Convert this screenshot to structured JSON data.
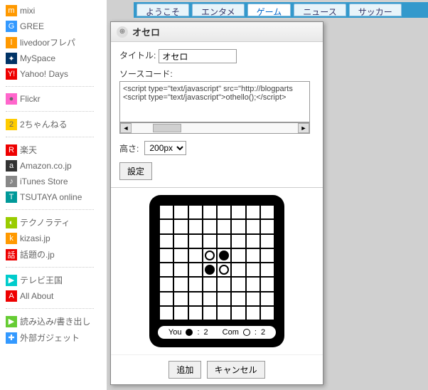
{
  "sidebar": {
    "groups": [
      [
        {
          "label": "mixi",
          "icon": "m",
          "cls": "ic-orange"
        },
        {
          "label": "GREE",
          "icon": "G",
          "cls": "ic-blue"
        },
        {
          "label": "livedoorフレパ",
          "icon": "l",
          "cls": "ic-orange"
        },
        {
          "label": "MySpace",
          "icon": "✦",
          "cls": "ic-dblue"
        },
        {
          "label": "Yahoo! Days",
          "icon": "Y!",
          "cls": "ic-red"
        }
      ],
      [
        {
          "label": "Flickr",
          "icon": "●",
          "cls": "ic-pink"
        }
      ],
      [
        {
          "label": "2ちゃんねる",
          "icon": "2",
          "cls": "ic-yellow"
        }
      ],
      [
        {
          "label": "楽天",
          "icon": "R",
          "cls": "ic-red"
        },
        {
          "label": "Amazon.co.jp",
          "icon": "a",
          "cls": "ic-dark"
        },
        {
          "label": "iTunes Store",
          "icon": "♪",
          "cls": "ic-gray"
        },
        {
          "label": "TSUTAYA online",
          "icon": "T",
          "cls": "ic-teal"
        }
      ],
      [
        {
          "label": "テクノラティ",
          "icon": "◐",
          "cls": "ic-lime"
        },
        {
          "label": "kizasi.jp",
          "icon": "k",
          "cls": "ic-orange"
        },
        {
          "label": "話題の.jp",
          "icon": "話",
          "cls": "ic-red"
        }
      ],
      [
        {
          "label": "テレビ王国",
          "icon": "▶",
          "cls": "ic-cyan"
        },
        {
          "label": "All About",
          "icon": "A",
          "cls": "ic-red"
        }
      ],
      [
        {
          "label": "読み込み/書き出し",
          "icon": "▶",
          "cls": "ic-green"
        },
        {
          "label": "外部ガジェット",
          "icon": "✚",
          "cls": "ic-blue"
        }
      ]
    ]
  },
  "tabs": [
    {
      "label": "ようこそ",
      "active": false
    },
    {
      "label": "エンタメ",
      "active": false
    },
    {
      "label": "ゲーム",
      "active": true
    },
    {
      "label": "ニュース",
      "active": false
    },
    {
      "label": "サッカー",
      "active": false
    }
  ],
  "dialog": {
    "title": "オセロ",
    "fields": {
      "title_label": "タイトル:",
      "title_value": "オセロ",
      "source_label": "ソースコード:",
      "source_value": "<script type=\"text/javascript\" src=\"http://blogparts\n<script type=\"text/javascript\">othello();</script>",
      "height_label": "高さ:",
      "height_value": "200px",
      "settings_btn": "設定"
    },
    "preview": {
      "board_pieces": [
        {
          "r": 3,
          "c": 3,
          "color": "white"
        },
        {
          "r": 3,
          "c": 4,
          "color": "black"
        },
        {
          "r": 4,
          "c": 3,
          "color": "black"
        },
        {
          "r": 4,
          "c": 4,
          "color": "white"
        }
      ],
      "score": {
        "you_label": "You",
        "you_val": "2",
        "com_label": "Com",
        "com_val": "2"
      }
    },
    "footer": {
      "add": "追加",
      "cancel": "キャンセル"
    }
  }
}
